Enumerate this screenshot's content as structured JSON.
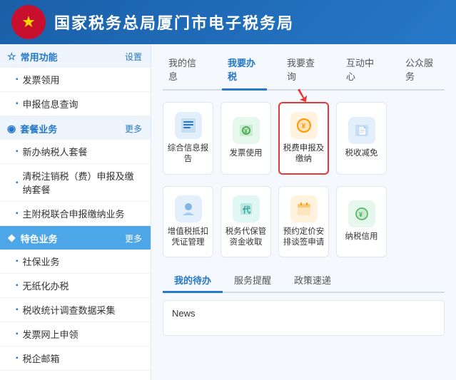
{
  "header": {
    "title": "国家税务总局厦门市电子税务局"
  },
  "sidebar": {
    "sections": [
      {
        "id": "common",
        "title": "常用功能",
        "icon": "★",
        "link": "设置",
        "highlighted": false,
        "items": [
          "发票领用",
          "申报信息查询"
        ]
      },
      {
        "id": "package",
        "title": "套餐业务",
        "icon": "◉",
        "link": "更多",
        "highlighted": false,
        "items": [
          "新办纳税人套餐",
          "清税注销税（费）申报及缴纳套餐",
          "主附税联合申报缴纳业务"
        ]
      },
      {
        "id": "special",
        "title": "特色业务",
        "icon": "❖",
        "link": "更多",
        "highlighted": true,
        "items": [
          "社保业务",
          "无纸化办税",
          "税收统计调查数据采集",
          "发票网上申领",
          "税企邮箱"
        ]
      }
    ]
  },
  "main": {
    "tabs": [
      {
        "id": "my-info",
        "label": "我的信息",
        "active": false
      },
      {
        "id": "my-work",
        "label": "我要办税",
        "active": true
      },
      {
        "id": "my-query",
        "label": "我要查询",
        "active": false
      },
      {
        "id": "interact",
        "label": "互动中心",
        "active": false
      },
      {
        "id": "public",
        "label": "公众服务",
        "active": false
      }
    ],
    "icon_grid_row1": [
      {
        "id": "comprehensive-report",
        "label": "综合信息报告",
        "icon": "📋",
        "color": "blue",
        "highlighted": false
      },
      {
        "id": "invoice-use",
        "label": "发票使用",
        "icon": "🧾",
        "color": "green",
        "highlighted": false
      },
      {
        "id": "tax-declare",
        "label": "税费申报及缴纳",
        "icon": "¥",
        "color": "orange",
        "highlighted": true
      },
      {
        "id": "tax-reduce",
        "label": "税收减免",
        "icon": "📄",
        "color": "blue",
        "highlighted": false
      },
      {
        "id": "empty1",
        "label": "",
        "icon": "",
        "color": "blue",
        "highlighted": false
      }
    ],
    "icon_grid_row2": [
      {
        "id": "vat-manage",
        "label": "增值税抵扣凭证管理",
        "icon": "👤",
        "color": "blue",
        "highlighted": false
      },
      {
        "id": "tax-agent",
        "label": "税务代保管资金收取",
        "icon": "代",
        "color": "teal",
        "highlighted": false
      },
      {
        "id": "appointment",
        "label": "预约定价安排谈签申请",
        "icon": "📅",
        "color": "orange",
        "highlighted": false
      },
      {
        "id": "credit",
        "label": "纳税信用",
        "icon": "¥",
        "color": "green",
        "highlighted": false
      },
      {
        "id": "empty2",
        "label": "",
        "icon": "",
        "color": "blue",
        "highlighted": false
      }
    ],
    "bottom_tabs": [
      {
        "id": "pending",
        "label": "我的待办",
        "active": true
      },
      {
        "id": "service-remind",
        "label": "服务提醒",
        "active": false
      },
      {
        "id": "policy",
        "label": "政策速递",
        "active": false
      }
    ],
    "news_label": "News"
  }
}
